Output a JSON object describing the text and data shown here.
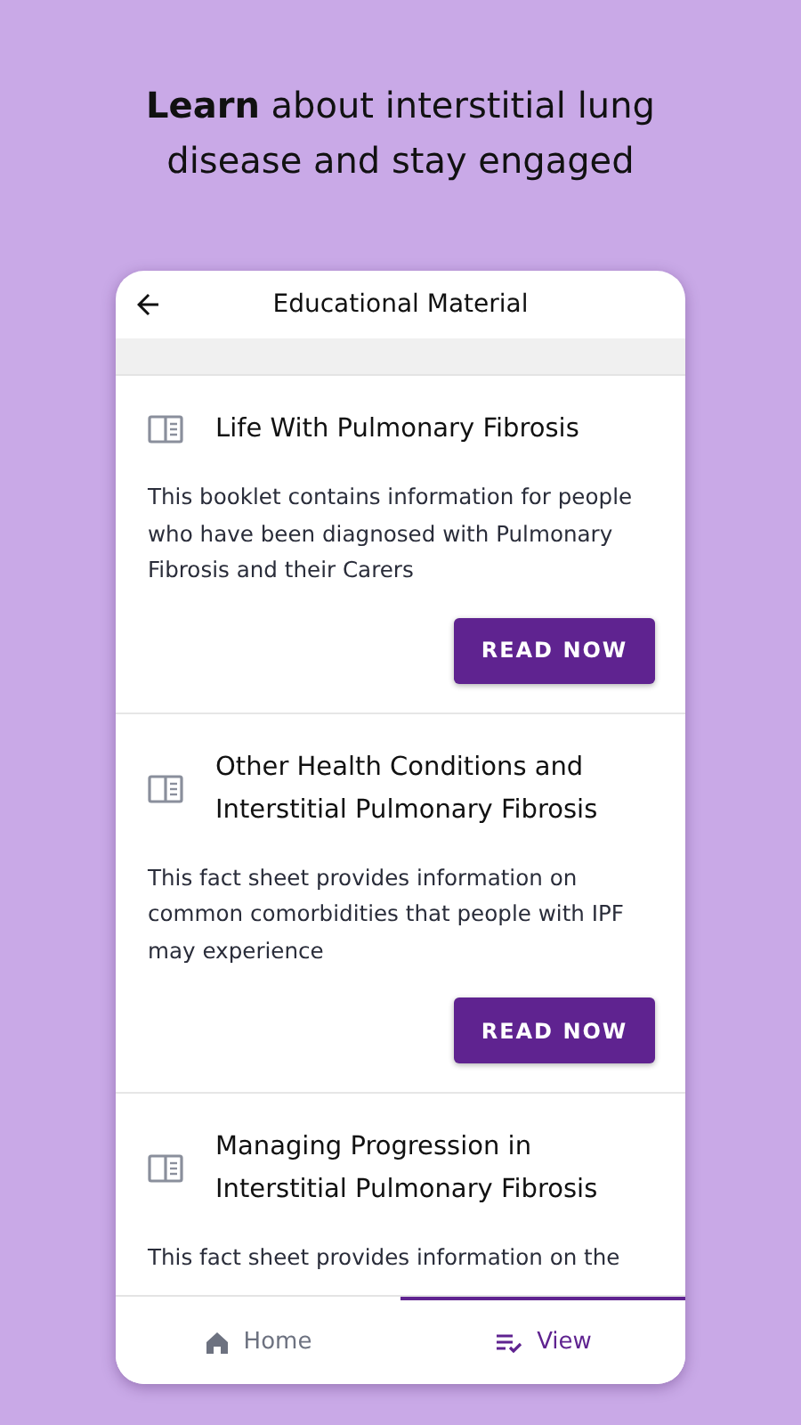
{
  "headline": {
    "text": "**Learn** about interstitial lung disease and stay engaged"
  },
  "app_bar": {
    "title": "Educational Material"
  },
  "materials": [
    {
      "title": "Life With Pulmonary Fibrosis",
      "description": "This booklet contains information for people who have been diagnosed with Pulmonary Fibrosis and their Carers",
      "button": "READ NOW"
    },
    {
      "title": "Other Health Conditions and Interstitial Pulmonary Fibrosis",
      "description": "This fact sheet provides information on common comorbidities that people with IPF may experience",
      "button": "READ NOW"
    },
    {
      "title": "Managing Progression in Interstitial Pulmonary Fibrosis",
      "description": "This fact sheet provides information on the"
    }
  ],
  "bottom_nav": [
    {
      "label": "Home",
      "selected": false
    },
    {
      "label": "View",
      "selected": true
    }
  ]
}
